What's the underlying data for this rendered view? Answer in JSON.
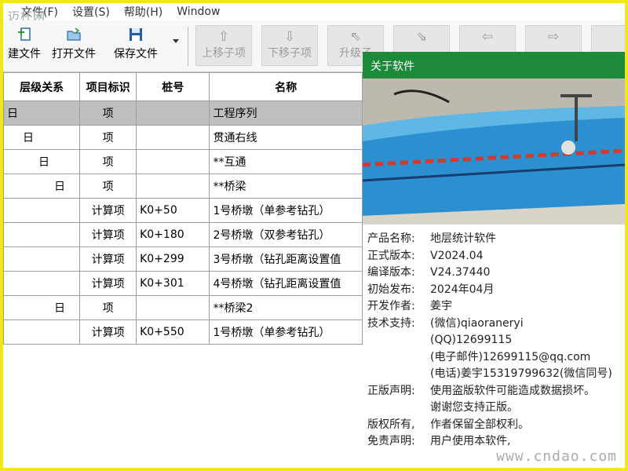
{
  "watermark_top": "迈杯网",
  "watermark_bottom": "www.cndao.com",
  "menu": {
    "items": [
      "文件(F)",
      "设置(S)",
      "帮助(H)",
      "Window"
    ]
  },
  "toolbar": {
    "new_label": "建文件",
    "open_label": "打开文件",
    "save_label": "保存文件",
    "move_up_label": "上移子项",
    "move_down_label": "下移子项",
    "promote_label": "升级子"
  },
  "table": {
    "headers": [
      "层级关系",
      "项目标识",
      "桩号",
      "名称"
    ],
    "rows": [
      {
        "level": "日",
        "indent": 0,
        "type": "项",
        "station": "",
        "name": "工程序列",
        "selected": true
      },
      {
        "level": "日",
        "indent": 1,
        "type": "项",
        "station": "",
        "name": "贯通右线"
      },
      {
        "level": "日",
        "indent": 2,
        "type": "项",
        "station": "",
        "name": "**互通"
      },
      {
        "level": "日",
        "indent": 3,
        "type": "项",
        "station": "",
        "name": "**桥梁"
      },
      {
        "level": "",
        "indent": 0,
        "type": "计算项",
        "station": "K0+50",
        "name": "1号桥墩（单参考钻孔）"
      },
      {
        "level": "",
        "indent": 0,
        "type": "计算项",
        "station": "K0+180",
        "name": "2号桥墩（双参考钻孔）"
      },
      {
        "level": "",
        "indent": 0,
        "type": "计算项",
        "station": "K0+299",
        "name": "3号桥墩（钻孔距离设置值"
      },
      {
        "level": "",
        "indent": 0,
        "type": "计算项",
        "station": "K0+301",
        "name": "4号桥墩（钻孔距离设置值"
      },
      {
        "level": "日",
        "indent": 3,
        "type": "项",
        "station": "",
        "name": "**桥梁2"
      },
      {
        "level": "",
        "indent": 0,
        "type": "计算项",
        "station": "K0+550",
        "name": "1号桥墩（单参考钻孔）"
      }
    ]
  },
  "about": {
    "title": "关于软件",
    "fields": [
      {
        "k": "产品名称:",
        "v": "地层统计软件"
      },
      {
        "k": "正式版本:",
        "v": "V2024.04"
      },
      {
        "k": "编译版本:",
        "v": "V24.37440"
      },
      {
        "k": "初始发布:",
        "v": "2024年04月"
      },
      {
        "k": "开发作者:",
        "v": "姜宇"
      },
      {
        "k": "技术支持:",
        "v": "(微信)qiaoraneryi"
      },
      {
        "k": "",
        "v": "(QQ)12699115"
      },
      {
        "k": "",
        "v": "(电子邮件)12699115@qq.com"
      },
      {
        "k": "",
        "v": "(电话)姜宇15319799632(微信同号)"
      },
      {
        "k": "正版声明:",
        "v": "使用盗版软件可能造成数据损坏。"
      },
      {
        "k": "",
        "v": "谢谢您支持正版。"
      },
      {
        "k": "",
        "v": ""
      },
      {
        "k": "版权所有,",
        "v": "作者保留全部权利。"
      },
      {
        "k": "免责声明:",
        "v": "用户使用本软件,"
      }
    ]
  },
  "colors": {
    "accent": "#1d8a3a",
    "frame": "#f2e61a",
    "selected_row": "#bfbfbf"
  }
}
